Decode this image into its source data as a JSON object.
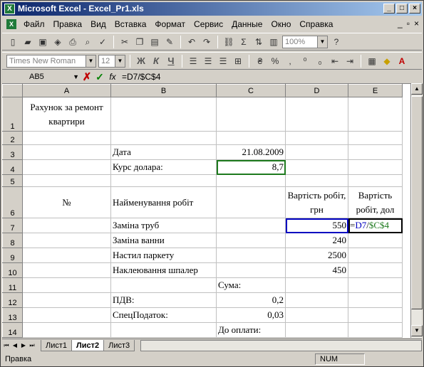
{
  "window": {
    "title": "Microsoft Excel - Excel_Pr1.xls",
    "app_icon": "X"
  },
  "menu": [
    "Файл",
    "Правка",
    "Вид",
    "Вставка",
    "Формат",
    "Сервис",
    "Данные",
    "Окно",
    "Справка"
  ],
  "toolbar": {
    "zoom": "100%",
    "font_name": "Times New Roman",
    "font_size": "12"
  },
  "formula_bar": {
    "name_box": "AB5",
    "formula": "=D7/$C$4"
  },
  "columns": [
    "A",
    "B",
    "C",
    "D",
    "E"
  ],
  "rows": {
    "1": {
      "A": "Рахунок за ремонт квартири"
    },
    "3": {
      "B": "Дата",
      "C": "21.08.2009"
    },
    "4": {
      "B": "Курс долара:",
      "C": "8,7"
    },
    "6": {
      "A": "№",
      "B": "Найменування робіт",
      "D": "Вартість робіт, грн",
      "E": "Вартість робіт, дол"
    },
    "7": {
      "B": "Заміна труб",
      "D": "550",
      "E_prefix": "=",
      "E_ref1": "D7",
      "E_sep": "/",
      "E_ref2": "$C$4"
    },
    "8": {
      "B": "Заміна ванни",
      "D": "240"
    },
    "9": {
      "B": "Настил паркету",
      "D": "2500"
    },
    "10": {
      "B": "Наклеювання шпалер",
      "D": "450"
    },
    "11": {
      "C": "Сума:"
    },
    "12": {
      "B": "ПДВ:",
      "C": "0,2"
    },
    "13": {
      "B": "СпецПодаток:",
      "C": "0,03"
    },
    "14": {
      "C": "До оплати:"
    }
  },
  "row_numbers": [
    "1",
    "2",
    "3",
    "4",
    "5",
    "6",
    "7",
    "8",
    "9",
    "10",
    "11",
    "12",
    "13",
    "14"
  ],
  "sheet_tabs": [
    "Лист1",
    "Лист2",
    "Лист3"
  ],
  "status": {
    "mode": "Правка",
    "num": "NUM"
  }
}
